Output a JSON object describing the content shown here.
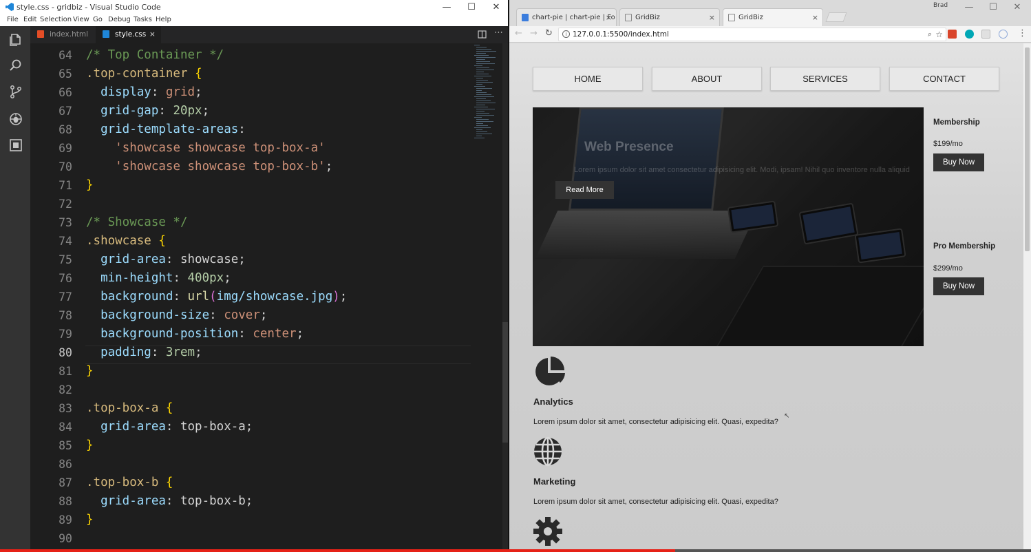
{
  "vscode": {
    "window_title": "style.css - gridbiz - Visual Studio Code",
    "menu": [
      "File",
      "Edit",
      "Selection",
      "View",
      "Go",
      "Debug",
      "Tasks",
      "Help"
    ],
    "tabs": [
      {
        "label": "index.html",
        "icon": "html5-icon",
        "color": "#e44d26"
      },
      {
        "label": "style.css",
        "icon": "css3-icon",
        "color": "#1f86d8",
        "close": "×"
      }
    ],
    "activity_icons": [
      "explorer-icon",
      "search-icon",
      "source-control-icon",
      "debug-icon",
      "extensions-icon"
    ],
    "lines": [
      {
        "n": "64",
        "tokens": [
          [
            "/* Top Container */",
            "com"
          ]
        ]
      },
      {
        "n": "65",
        "tokens": [
          [
            ".top-container",
            "sel"
          ],
          [
            " ",
            ""
          ],
          [
            "{",
            "brc"
          ]
        ]
      },
      {
        "n": "66",
        "tokens": [
          [
            "  ",
            ""
          ],
          [
            "display",
            "prop"
          ],
          [
            ": ",
            ""
          ],
          [
            "grid",
            "val"
          ],
          [
            ";",
            ""
          ]
        ]
      },
      {
        "n": "67",
        "tokens": [
          [
            "  ",
            ""
          ],
          [
            "grid-gap",
            "prop"
          ],
          [
            ": ",
            ""
          ],
          [
            "20px",
            "num"
          ],
          [
            ";",
            ""
          ]
        ]
      },
      {
        "n": "68",
        "tokens": [
          [
            "  ",
            ""
          ],
          [
            "grid-template-areas",
            "prop"
          ],
          [
            ":",
            ""
          ]
        ]
      },
      {
        "n": "69",
        "tokens": [
          [
            "    ",
            ""
          ],
          [
            "'showcase showcase top-box-a'",
            "str"
          ]
        ]
      },
      {
        "n": "70",
        "tokens": [
          [
            "    ",
            ""
          ],
          [
            "'showcase showcase top-box-b'",
            "str"
          ],
          [
            ";",
            ""
          ]
        ]
      },
      {
        "n": "71",
        "tokens": [
          [
            "}",
            "brc"
          ]
        ]
      },
      {
        "n": "72",
        "tokens": []
      },
      {
        "n": "73",
        "tokens": [
          [
            "/* Showcase */",
            "com"
          ]
        ]
      },
      {
        "n": "74",
        "tokens": [
          [
            ".showcase",
            "sel"
          ],
          [
            " ",
            ""
          ],
          [
            "{",
            "brc"
          ]
        ]
      },
      {
        "n": "75",
        "tokens": [
          [
            "  ",
            ""
          ],
          [
            "grid-area",
            "prop"
          ],
          [
            ": showcase;",
            ""
          ]
        ]
      },
      {
        "n": "76",
        "tokens": [
          [
            "  ",
            ""
          ],
          [
            "min-height",
            "prop"
          ],
          [
            ": ",
            ""
          ],
          [
            "400px",
            "num"
          ],
          [
            ";",
            ""
          ]
        ]
      },
      {
        "n": "77",
        "tokens": [
          [
            "  ",
            ""
          ],
          [
            "background",
            "prop"
          ],
          [
            ": ",
            ""
          ],
          [
            "url",
            "fn"
          ],
          [
            "(",
            "par"
          ],
          [
            "img/showcase.jpg",
            "prop"
          ],
          [
            ")",
            "par"
          ],
          [
            ";",
            ""
          ]
        ]
      },
      {
        "n": "78",
        "tokens": [
          [
            "  ",
            ""
          ],
          [
            "background-size",
            "prop"
          ],
          [
            ": ",
            ""
          ],
          [
            "cover",
            "val"
          ],
          [
            ";",
            ""
          ]
        ]
      },
      {
        "n": "79",
        "tokens": [
          [
            "  ",
            ""
          ],
          [
            "background-position",
            "prop"
          ],
          [
            ": ",
            ""
          ],
          [
            "center",
            "val"
          ],
          [
            ";",
            ""
          ]
        ]
      },
      {
        "n": "80",
        "tokens": [
          [
            "  ",
            ""
          ],
          [
            "padding",
            "prop"
          ],
          [
            ": ",
            ""
          ],
          [
            "3rem",
            "num"
          ],
          [
            ";",
            ""
          ]
        ]
      },
      {
        "n": "81",
        "tokens": [
          [
            "}",
            "brc"
          ]
        ]
      },
      {
        "n": "82",
        "tokens": []
      },
      {
        "n": "83",
        "tokens": [
          [
            ".top-box-a",
            "sel"
          ],
          [
            " ",
            ""
          ],
          [
            "{",
            "brc"
          ]
        ]
      },
      {
        "n": "84",
        "tokens": [
          [
            "  ",
            ""
          ],
          [
            "grid-area",
            "prop"
          ],
          [
            ": top-box-a;",
            ""
          ]
        ]
      },
      {
        "n": "85",
        "tokens": [
          [
            "}",
            "brc"
          ]
        ]
      },
      {
        "n": "86",
        "tokens": []
      },
      {
        "n": "87",
        "tokens": [
          [
            ".top-box-b",
            "sel"
          ],
          [
            " ",
            ""
          ],
          [
            "{",
            "brc"
          ]
        ]
      },
      {
        "n": "88",
        "tokens": [
          [
            "  ",
            ""
          ],
          [
            "grid-area",
            "prop"
          ],
          [
            ": top-box-b;",
            ""
          ]
        ]
      },
      {
        "n": "89",
        "tokens": [
          [
            "}",
            "brc"
          ]
        ]
      },
      {
        "n": "90",
        "tokens": []
      }
    ],
    "current_line": "80"
  },
  "chrome": {
    "tabs": [
      {
        "label": "chart-pie | chart-pie | Fo",
        "active": false,
        "favicon": "bookmark-icon",
        "favicon_color": "#3b7ddd",
        "close": "×"
      },
      {
        "label": "GridBiz",
        "active": false,
        "favicon": "page-icon",
        "close": "×"
      },
      {
        "label": "GridBiz",
        "active": true,
        "favicon": "page-icon",
        "close": "×"
      }
    ],
    "user": "Brad",
    "url": "127.0.0.1:5500/index.html",
    "extension_colors": [
      "#d9442a",
      "#00a7b5",
      "#cfcfcf",
      "#8aa6d8"
    ]
  },
  "site": {
    "nav": [
      "HOME",
      "ABOUT",
      "SERVICES",
      "CONTACT"
    ],
    "showcase": {
      "title": "Web Presence",
      "text": "Lorem ipsum dolor sit amet consectetur adipisicing elit. Modi, ipsam! Nihil quo inventore nulla aliquid",
      "button": "Read More"
    },
    "boxes": [
      {
        "title": "Membership",
        "price": "$199/mo",
        "button": "Buy Now"
      },
      {
        "title": "Pro Membership",
        "price": "$299/mo",
        "button": "Buy Now"
      }
    ],
    "features": [
      {
        "icon": "chart-pie-icon",
        "title": "Analytics",
        "text": "Lorem ipsum dolor sit amet, consectetur adipisicing elit. Quasi, expedita?"
      },
      {
        "icon": "globe-icon",
        "title": "Marketing",
        "text": "Lorem ipsum dolor sit amet, consectetur adipisicing elit. Quasi, expedita?"
      },
      {
        "icon": "cog-icon",
        "title": "",
        "text": ""
      }
    ]
  },
  "video_progress": 0.655,
  "colors": {
    "progress": "#e62117",
    "vscode_bg": "#1e1e1e",
    "button_dark": "#333333"
  }
}
